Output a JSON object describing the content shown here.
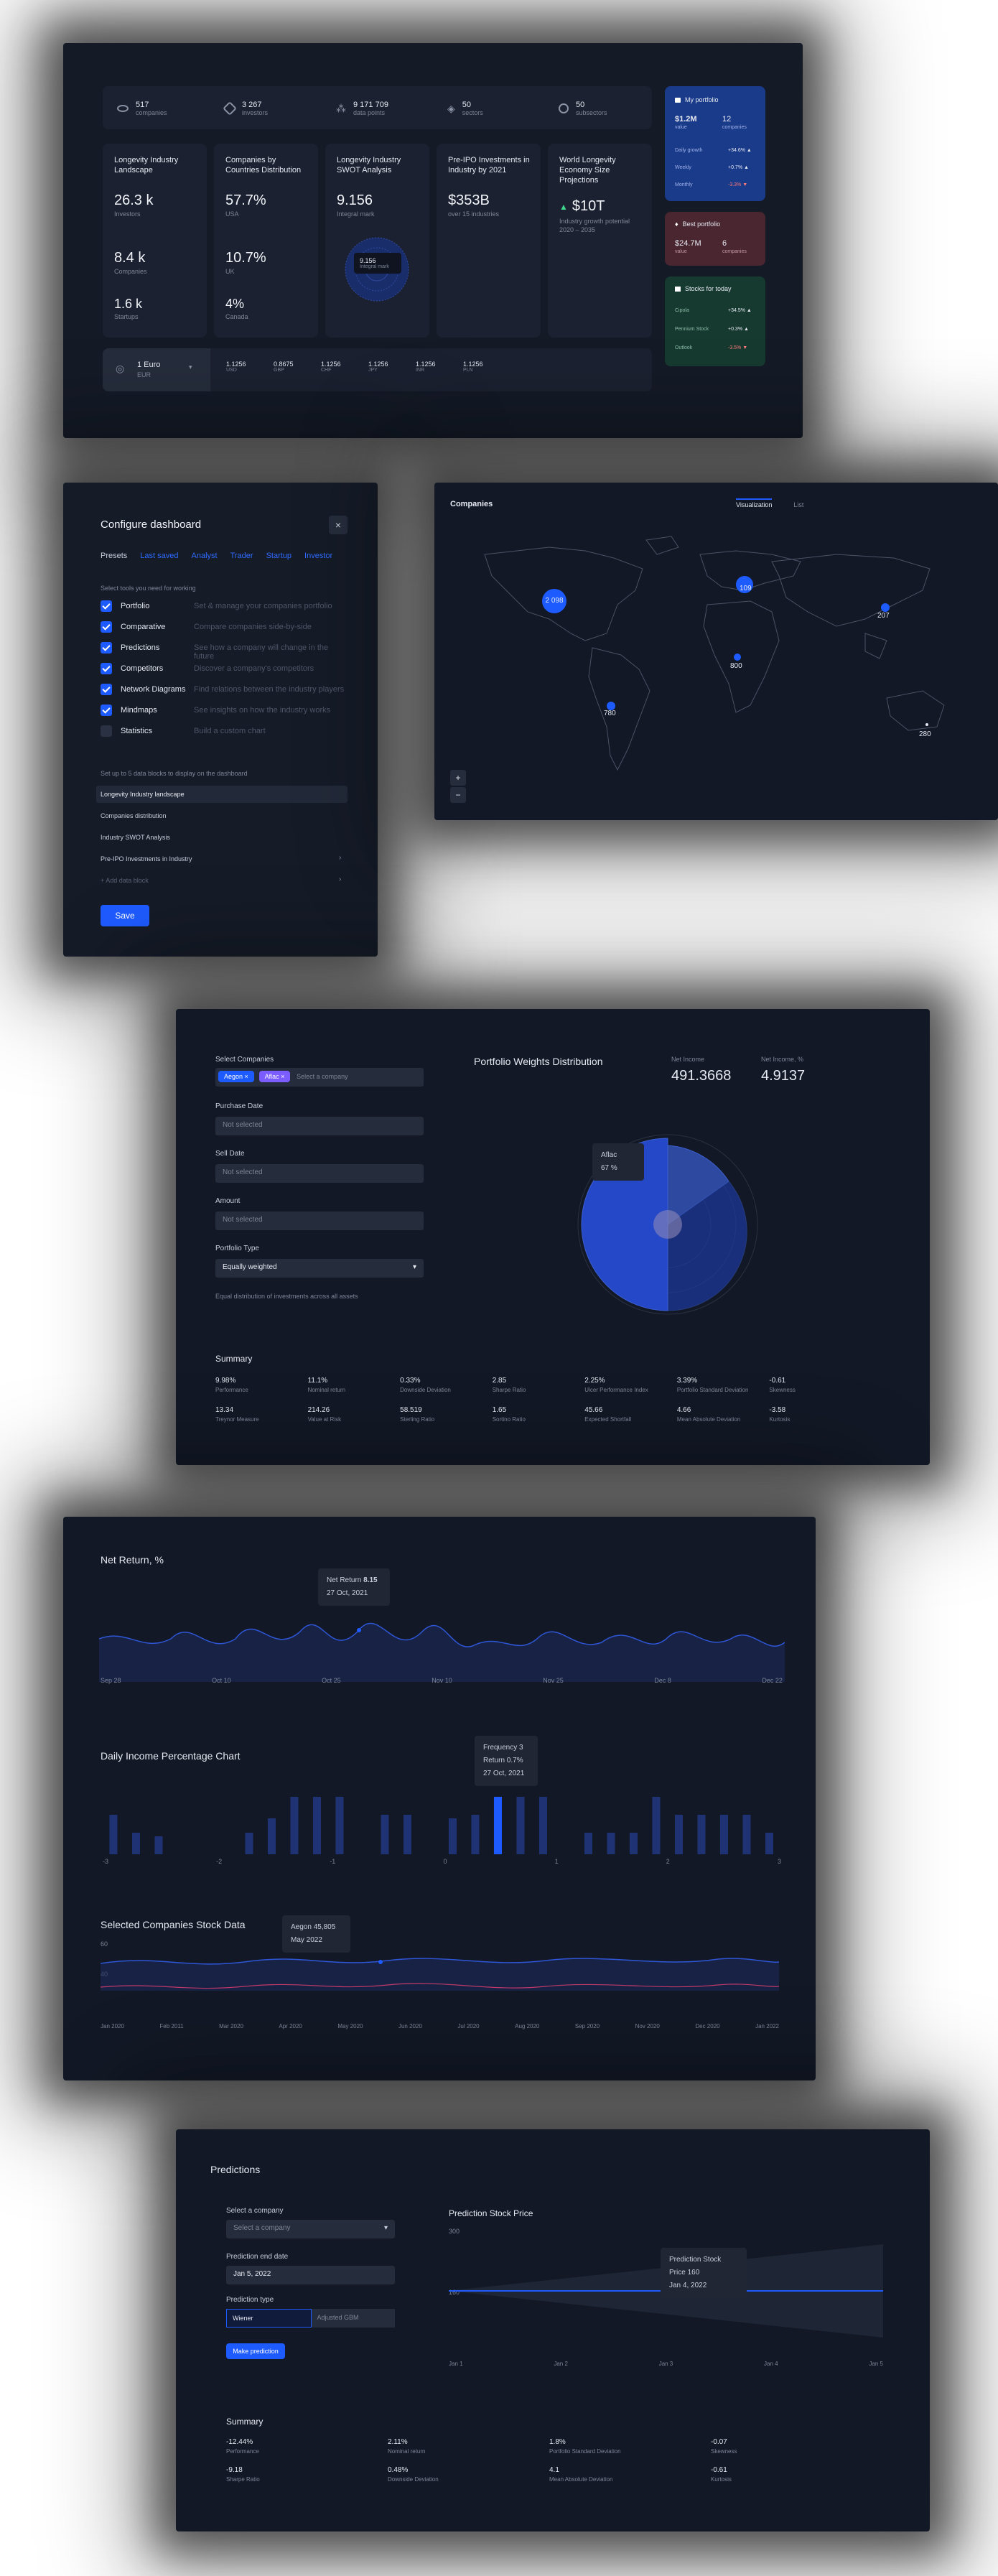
{
  "dashboard": {
    "stats": [
      {
        "icon": "eye-icon",
        "value": "517",
        "label": "companies"
      },
      {
        "icon": "link-icon",
        "value": "3 267",
        "label": "investors"
      },
      {
        "icon": "nodes-icon",
        "value": "9 171 709",
        "label": "data points"
      },
      {
        "icon": "grid-icon",
        "value": "50",
        "label": "sectors"
      },
      {
        "icon": "pie-icon",
        "value": "50",
        "label": "subsectors"
      }
    ],
    "tiles": [
      {
        "title": "Longevity Industry Landscape",
        "rows": [
          {
            "value": "26.3 k",
            "label": "Investors"
          },
          {
            "value": "8.4 k",
            "label": "Companies"
          },
          {
            "value": "1.6 k",
            "label": "Startups"
          }
        ]
      },
      {
        "title": "Companies by Countries Distribution",
        "rows": [
          {
            "value": "57.7%",
            "label": "USA"
          },
          {
            "value": "10.7%",
            "label": "UK"
          },
          {
            "value": "4%",
            "label": "Canada"
          }
        ]
      },
      {
        "title": "Longevity Industry SWOT Analysis",
        "value": "9.156",
        "label": "Integral mark",
        "badge_value": "9.156",
        "badge_label": "Integral mark"
      },
      {
        "title": "Pre-IPO Investments in Industry by 2021",
        "value": "$353B",
        "label": "over 15 industries"
      },
      {
        "title": "World Longevity Economy Size Projections",
        "value": "$10T",
        "label": "Industry growth potential 2020 – 2035"
      }
    ],
    "currency": {
      "name": "1 Euro",
      "code": "EUR",
      "rates": [
        {
          "value": "1.1256",
          "code": "USD"
        },
        {
          "value": "0.8675",
          "code": "GBP"
        },
        {
          "value": "1.1256",
          "code": "CHF"
        },
        {
          "value": "1.1256",
          "code": "JPY"
        },
        {
          "value": "1.1256",
          "code": "INR"
        },
        {
          "value": "1.1256",
          "code": "PLN"
        }
      ]
    },
    "portfolio": {
      "title": "My portfolio",
      "value": "$1.2M",
      "value_label": "value",
      "count": "12",
      "count_label": "companies",
      "rows": [
        {
          "label": "Daily growth",
          "value": "+34.6% ▲"
        },
        {
          "label": "Weekly",
          "value": "+0.7% ▲"
        },
        {
          "label": "Monthly",
          "value": "-3.3% ▼"
        }
      ]
    },
    "best": {
      "title": "Best portfolio",
      "value": "$24.7M",
      "value_label": "value",
      "count": "6",
      "count_label": "companies"
    },
    "stocks": {
      "title": "Stocks for today",
      "rows": [
        {
          "label": "Cipola",
          "value": "+34.5% ▲"
        },
        {
          "label": "Pennium Stock",
          "value": "+0.3% ▲"
        },
        {
          "label": "Outlook",
          "value": "-3.5% ▼"
        }
      ]
    },
    "colors": {
      "accent": "#1e5bff",
      "positive": "#3dd68c",
      "negative": "#ff5a5a"
    }
  },
  "configure": {
    "title": "Configure dashboard",
    "close": "×",
    "tabs": [
      "Presets",
      "Last saved",
      "Analyst",
      "Trader",
      "Startup",
      "Investor"
    ],
    "tools_caption": "Select tools you need for working",
    "tools": [
      {
        "name": "Portfolio",
        "desc": "Set & manage your companies portfolio",
        "checked": true
      },
      {
        "name": "Comparative",
        "desc": "Compare companies side-by-side",
        "checked": true
      },
      {
        "name": "Predictions",
        "desc": "See how a company will change in the future",
        "checked": true
      },
      {
        "name": "Competitors",
        "desc": "Discover a company's competitors",
        "checked": true
      },
      {
        "name": "Network Diagrams",
        "desc": "Find relations between the industry players",
        "checked": true
      },
      {
        "name": "Mindmaps",
        "desc": "See insights on how the industry works",
        "checked": true
      },
      {
        "name": "Statistics",
        "desc": "Build a custom chart",
        "checked": false
      }
    ],
    "blocks_caption": "Set up to 5 data blocks to display on the dashboard",
    "blocks": [
      "Longevity Industry landscape",
      "Companies distribution",
      "Industry SWOT Analysis",
      "Pre-IPO Investments in Industry"
    ],
    "add_block": "+ Add data block",
    "save": "Save"
  },
  "map": {
    "title": "Companies",
    "tabs": [
      "Visualization",
      "List"
    ],
    "bubbles": [
      {
        "value": "2 098"
      },
      {
        "value": "109"
      },
      {
        "value": "207"
      },
      {
        "value": "800"
      },
      {
        "value": "780"
      },
      {
        "value": "280"
      }
    ],
    "zoom_in": "+",
    "zoom_out": "−"
  },
  "portfolio_form": {
    "select_label": "Select Companies",
    "chips": [
      "Aegon",
      "Aflac"
    ],
    "placeholder": "Select a company",
    "purchase_label": "Purchase Date",
    "purchase_value": "Not selected",
    "sell_label": "Sell Date",
    "sell_value": "Not selected",
    "amount_label": "Amount",
    "amount_value": "Not selected",
    "type_label": "Portfolio Type",
    "type_value": "Equally weighted",
    "note": "Equal distribution of investments across all assets",
    "chart_title": "Portfolio Weights Distribution",
    "income1_label": "Net Income",
    "income1_value": "491.3668",
    "income2_label": "Net Income, %",
    "income2_value": "4.9137",
    "tooltip_name": "Aflac",
    "tooltip_value": "67 %",
    "summary_title": "Summary",
    "summary": [
      {
        "v": "9.98%",
        "l": "Performance"
      },
      {
        "v": "11.1%",
        "l": "Nominal return"
      },
      {
        "v": "0.33%",
        "l": "Downside Deviation"
      },
      {
        "v": "2.85",
        "l": "Sharpe Ratio"
      },
      {
        "v": "2.25%",
        "l": "Ulcer Performance Index"
      },
      {
        "v": "3.39%",
        "l": "Portfolio Standard Deviation"
      },
      {
        "v": "-0.61",
        "l": "Skewness"
      },
      {
        "v": "13.34",
        "l": "Treynor Measure"
      },
      {
        "v": "214.26",
        "l": "Value at Risk"
      },
      {
        "v": "58.519",
        "l": "Sterling Ratio"
      },
      {
        "v": "1.65",
        "l": "Sortino Ratio"
      },
      {
        "v": "45.66",
        "l": "Expected Shortfall"
      },
      {
        "v": "4.66",
        "l": "Mean Absolute Deviation"
      },
      {
        "v": "-3.58",
        "l": "Kurtosis"
      }
    ]
  },
  "netreturn": {
    "title": "Net Return, %",
    "tooltip_label": "Net Return",
    "tooltip_value": "8.15",
    "tooltip_date": "27 Oct, 2021",
    "xlabels": [
      "Sep 28",
      "Oct 10",
      "Oct 25",
      "Nov 10",
      "Nov 25",
      "Dec 8",
      "Dec 22"
    ]
  },
  "daily": {
    "title": "Daily Income Percentage Chart",
    "tooltip_freq_label": "Frequency",
    "tooltip_freq": "3",
    "tooltip_ret_label": "Return",
    "tooltip_ret": "0.7%",
    "tooltip_date": "27 Oct, 2021",
    "xlabels": [
      "-3",
      "-2",
      "-1",
      "0",
      "1",
      "2",
      "3"
    ]
  },
  "stock": {
    "title": "Selected Companies Stock Data",
    "tooltip_label": "Aegon",
    "tooltip_value": "45,805",
    "tooltip_date": "May 2022",
    "y_top": "60",
    "y_bottom": "40",
    "xlabels": [
      "Jan 2020",
      "Feb 2011",
      "Mar 2020",
      "Apr 2020",
      "May 2020",
      "Jun 2020",
      "Jul 2020",
      "Aug 2020",
      "Sep 2020",
      "Nov 2020",
      "Dec 2020",
      "Jan 2022"
    ]
  },
  "predictions": {
    "title": "Predictions",
    "company_label": "Select a company",
    "company_placeholder": "Select a company",
    "date_label": "Prediction end date",
    "date_value": "Jan 5, 2022",
    "type_label": "Prediction type",
    "type_options": [
      "Wiener",
      "Adjusted GBM"
    ],
    "button": "Make prediction",
    "chart_title": "Prediction Stock Price",
    "y_top": "300",
    "y_mid": "160",
    "tooltip_label": "Prediction Stock Price",
    "tooltip_value": "160",
    "tooltip_date": "Jan 4, 2022",
    "xlabels": [
      "Jan 1",
      "Jan 2",
      "Jan 3",
      "Jan 4",
      "Jan 5"
    ],
    "summary_title": "Summary",
    "summary": [
      {
        "v": "-12.44%",
        "l": "Performance"
      },
      {
        "v": "2.11%",
        "l": "Nominal return"
      },
      {
        "v": "1.8%",
        "l": "Portfolio Standard Deviation"
      },
      {
        "v": "-0.07",
        "l": "Skewness"
      },
      {
        "v": "-9.18",
        "l": "Sharpe Ratio"
      },
      {
        "v": "0.48%",
        "l": "Downside Deviation"
      },
      {
        "v": "4.1",
        "l": "Mean Absolute Deviation"
      },
      {
        "v": "-0.61",
        "l": "Kurtosis"
      }
    ]
  }
}
